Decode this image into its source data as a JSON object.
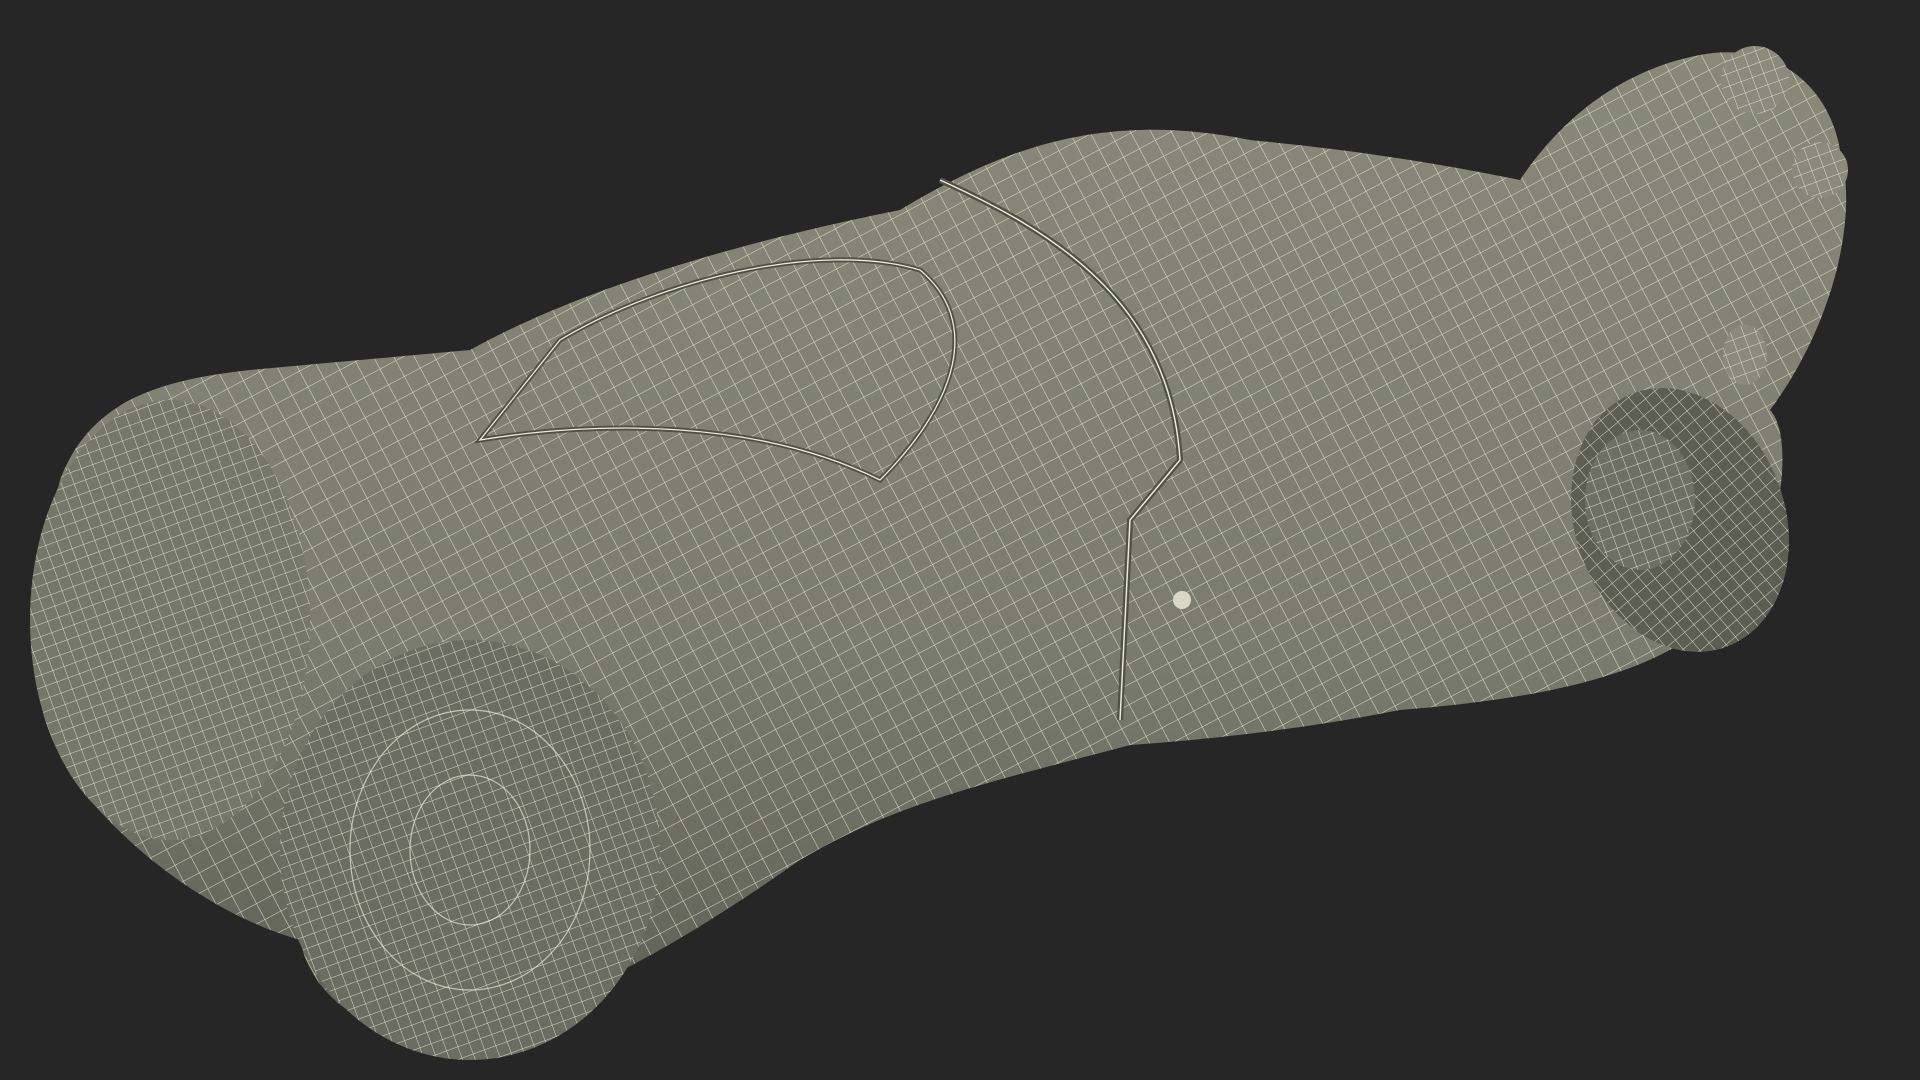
{
  "scene": {
    "subject": "wireframe-3d-mannequin-torso",
    "colors": {
      "background": "#262626",
      "surface": "#7b7c70",
      "surface_shadow": "#5f6055",
      "wire": "#ecebd9"
    }
  }
}
